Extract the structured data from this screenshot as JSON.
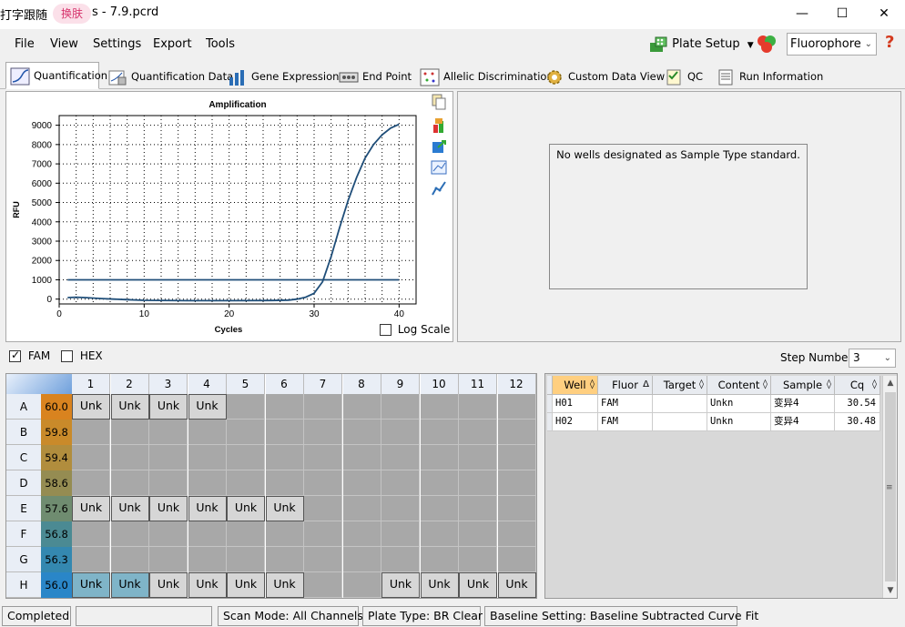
{
  "titlebar": {
    "title_prefix": "打字跟随",
    "skin_label": "换肤",
    "title_suffix": "s - 7.9.pcrd",
    "minimize": "—",
    "maximize": "☐",
    "close": "✕"
  },
  "menu": {
    "file": "File",
    "view": "View",
    "settings": "Settings",
    "export": "Export",
    "tools": "Tools",
    "plate_setup": "Plate Setup",
    "fluorophore": "Fluorophore",
    "help": "?"
  },
  "tabs": [
    {
      "label": "Quantification",
      "active": true
    },
    {
      "label": "Quantification Data"
    },
    {
      "label": "Gene Expression"
    },
    {
      "label": "End Point"
    },
    {
      "label": "Allelic Discrimination"
    },
    {
      "label": "Custom Data View"
    },
    {
      "label": "QC"
    },
    {
      "label": "Run Information"
    }
  ],
  "amplification": {
    "log_scale_label": "Log Scale",
    "log_scale_checked": false
  },
  "chart_data": {
    "type": "line",
    "title": "Amplification",
    "xlabel": "Cycles",
    "ylabel": "RFU",
    "xlim": [
      0,
      42
    ],
    "ylim": [
      -250,
      9500
    ],
    "xticks": [
      0,
      10,
      20,
      30,
      40
    ],
    "yticks": [
      0,
      1000,
      2000,
      3000,
      4000,
      5000,
      6000,
      7000,
      8000,
      9000
    ],
    "grid": true,
    "series": [
      {
        "color": "#1f4e79",
        "x": [
          1,
          2,
          3,
          5,
          8,
          10,
          15,
          20,
          25,
          27,
          28,
          29,
          30,
          31,
          32,
          33,
          34,
          35,
          36,
          37,
          38,
          39,
          40
        ],
        "y": [
          80,
          100,
          80,
          30,
          -30,
          -60,
          -80,
          -80,
          -70,
          -50,
          0,
          100,
          300,
          900,
          2200,
          3700,
          5100,
          6300,
          7300,
          8000,
          8500,
          8850,
          9050
        ]
      },
      {
        "color": "#1f4e79",
        "x": [
          1,
          40
        ],
        "y": [
          1000,
          1000
        ]
      }
    ]
  },
  "standard_curve": {
    "message": "No wells designated as Sample Type standard."
  },
  "channels": {
    "fam": "FAM",
    "fam_checked": true,
    "hex": "HEX",
    "hex_checked": false,
    "step_label": "Step Number:",
    "step_value": "3"
  },
  "plate": {
    "columns": [
      "1",
      "2",
      "3",
      "4",
      "5",
      "6",
      "7",
      "8",
      "9",
      "10",
      "11",
      "12"
    ],
    "rows": [
      {
        "label": "A",
        "temp": "60.0",
        "temp_color": "#d9831f",
        "wells": [
          "Unk",
          "Unk",
          "Unk",
          "Unk",
          "",
          "",
          "",
          "",
          "",
          "",
          "",
          ""
        ]
      },
      {
        "label": "B",
        "temp": "59.8",
        "temp_color": "#c98a2a",
        "wells": [
          "",
          "",
          "",
          "",
          "",
          "",
          "",
          "",
          "",
          "",
          "",
          ""
        ]
      },
      {
        "label": "C",
        "temp": "59.4",
        "temp_color": "#b18d3d",
        "wells": [
          "",
          "",
          "",
          "",
          "",
          "",
          "",
          "",
          "",
          "",
          "",
          ""
        ]
      },
      {
        "label": "D",
        "temp": "58.6",
        "temp_color": "#958c52",
        "wells": [
          "",
          "",
          "",
          "",
          "",
          "",
          "",
          "",
          "",
          "",
          "",
          ""
        ]
      },
      {
        "label": "E",
        "temp": "57.6",
        "temp_color": "#6f8c70",
        "wells": [
          "Unk",
          "Unk",
          "Unk",
          "Unk",
          "Unk",
          "Unk",
          "",
          "",
          "",
          "",
          "",
          ""
        ]
      },
      {
        "label": "F",
        "temp": "56.8",
        "temp_color": "#4b8a93",
        "wells": [
          "",
          "",
          "",
          "",
          "",
          "",
          "",
          "",
          "",
          "",
          "",
          ""
        ]
      },
      {
        "label": "G",
        "temp": "56.3",
        "temp_color": "#3488b0",
        "wells": [
          "",
          "",
          "",
          "",
          "",
          "",
          "",
          "",
          "",
          "",
          "",
          ""
        ]
      },
      {
        "label": "H",
        "temp": "56.0",
        "temp_color": "#2a86c8",
        "wells": [
          "Unk",
          "Unk",
          "Unk",
          "Unk",
          "Unk",
          "Unk",
          "",
          "",
          "Unk",
          "Unk",
          "Unk",
          "Unk"
        ],
        "selected": [
          0,
          1
        ]
      }
    ]
  },
  "well_table": {
    "headers": [
      "Well",
      "Fluor",
      "Target",
      "Content",
      "Sample",
      "Cq"
    ],
    "rows": [
      [
        "H01",
        "FAM",
        "",
        "Unkn",
        "变异4",
        "30.54"
      ],
      [
        "H02",
        "FAM",
        "",
        "Unkn",
        "变异4",
        "30.48"
      ]
    ]
  },
  "status": {
    "completed": "Completed",
    "scan_mode": "Scan Mode: All Channels",
    "plate_type": "Plate Type: BR Clear",
    "baseline": "Baseline Setting: Baseline Subtracted Curve Fit"
  }
}
